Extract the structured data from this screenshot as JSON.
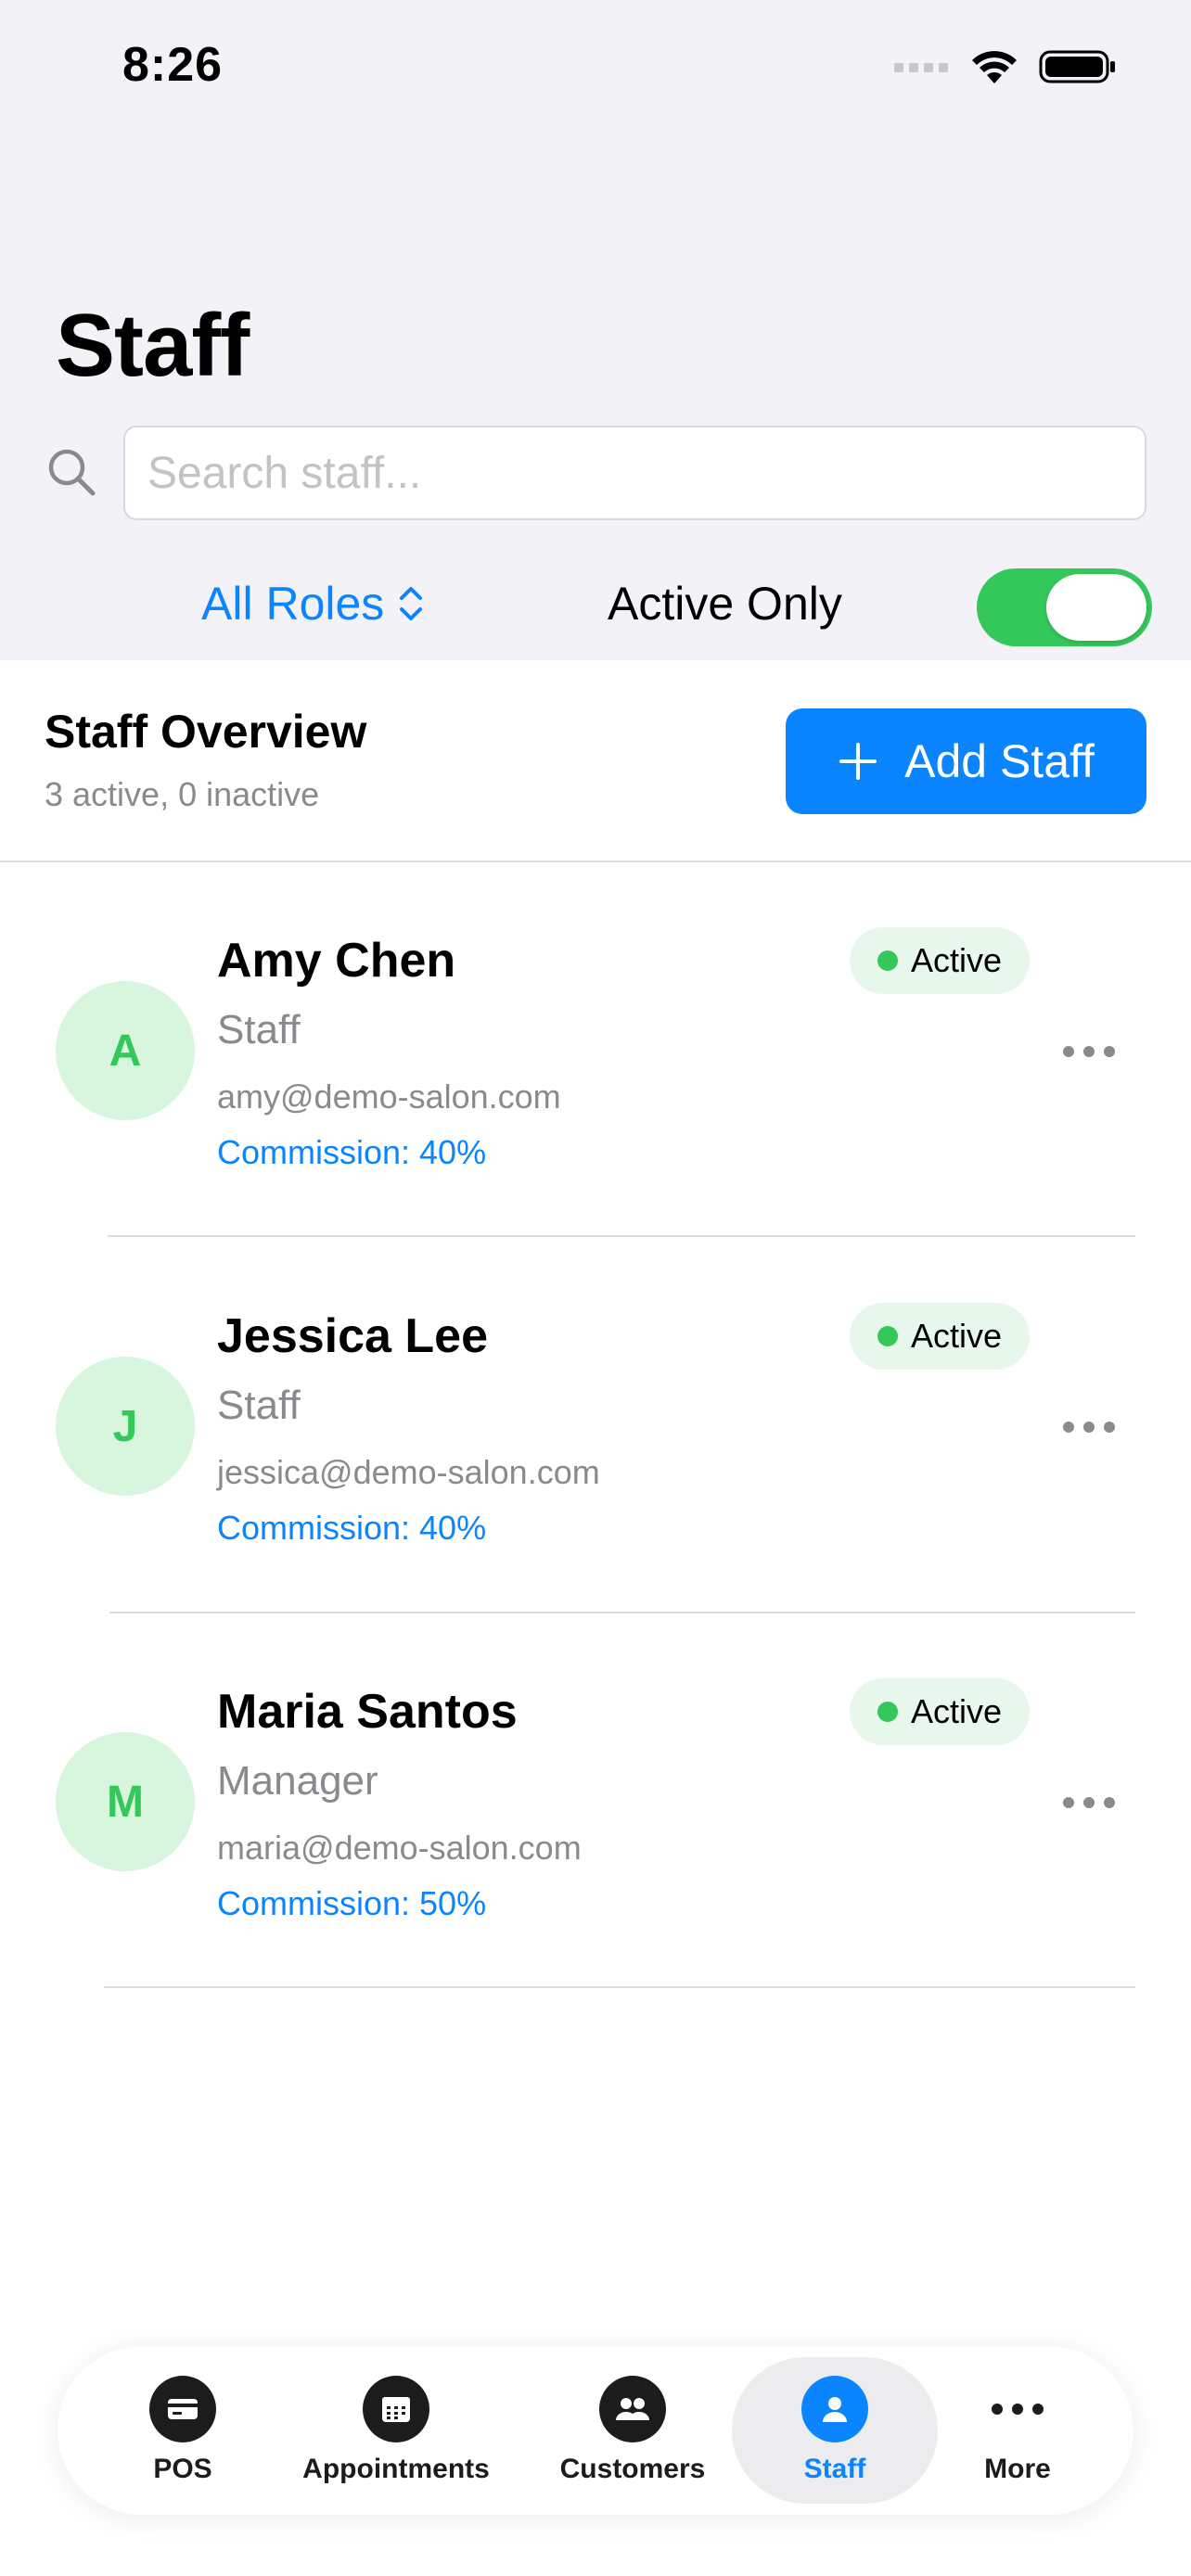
{
  "status_bar": {
    "time": "8:26"
  },
  "header": {
    "title": "Staff",
    "search": {
      "placeholder": "Search staff...",
      "value": ""
    },
    "roles_filter": {
      "selected": "All Roles"
    },
    "active_only": {
      "label": "Active Only",
      "enabled": true
    }
  },
  "overview": {
    "title": "Staff Overview",
    "summary": "3 active, 0 inactive",
    "add_button": "Add Staff"
  },
  "staff": [
    {
      "initial": "A",
      "name": "Amy Chen",
      "role": "Staff",
      "email": "amy@demo-salon.com",
      "commission": "Commission: 40%",
      "status": "Active"
    },
    {
      "initial": "J",
      "name": "Jessica Lee",
      "role": "Staff",
      "email": "jessica@demo-salon.com",
      "commission": "Commission: 40%",
      "status": "Active"
    },
    {
      "initial": "M",
      "name": "Maria Santos",
      "role": "Manager",
      "email": "maria@demo-salon.com",
      "commission": "Commission: 50%",
      "status": "Active"
    }
  ],
  "tabbar": {
    "items": [
      {
        "label": "POS",
        "icon": "card-icon"
      },
      {
        "label": "Appointments",
        "icon": "calendar-icon"
      },
      {
        "label": "Customers",
        "icon": "people-icon"
      },
      {
        "label": "Staff",
        "icon": "person-icon"
      },
      {
        "label": "More",
        "icon": "ellipsis-icon"
      }
    ],
    "selected": "Staff"
  },
  "colors": {
    "accent": "#0a84ff",
    "success": "#34c759",
    "background": "#f2f2f7"
  }
}
